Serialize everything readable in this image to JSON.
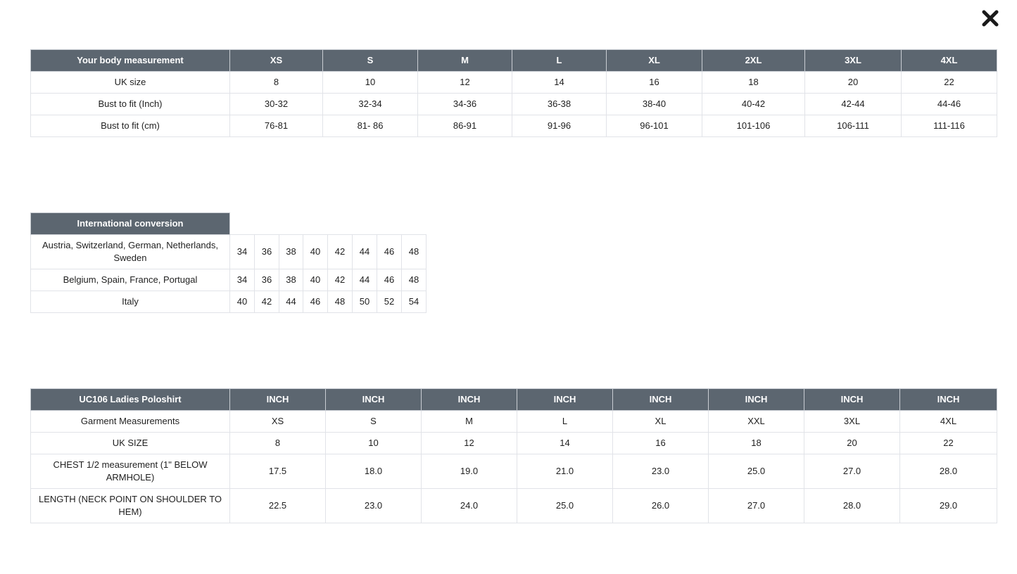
{
  "close_label": "Close",
  "body_table": {
    "header": [
      "Your body measurement",
      "XS",
      "S",
      "M",
      "L",
      "XL",
      "2XL",
      "3XL",
      "4XL"
    ],
    "rows": [
      [
        "UK size",
        "8",
        "10",
        "12",
        "14",
        "16",
        "18",
        "20",
        "22"
      ],
      [
        "Bust to fit (Inch)",
        "30-32",
        "32-34",
        "34-36",
        "36-38",
        "38-40",
        "40-42",
        "42-44",
        "44-46"
      ],
      [
        "Bust to fit (cm)",
        "76-81",
        "81- 86",
        "86-91",
        "91-96",
        "96-101",
        "101-106",
        "106-111",
        "111-116"
      ]
    ]
  },
  "intl_table": {
    "header": "International conversion",
    "rows": [
      [
        "Austria, Switzerland, German, Netherlands, Sweden",
        "34",
        "36",
        "38",
        "40",
        "42",
        "44",
        "46",
        "48"
      ],
      [
        "Belgium, Spain, France, Portugal",
        "34",
        "36",
        "38",
        "40",
        "42",
        "44",
        "46",
        "48"
      ],
      [
        "Italy",
        "40",
        "42",
        "44",
        "46",
        "48",
        "50",
        "52",
        "54"
      ]
    ]
  },
  "polo_table": {
    "header": [
      "UC106 Ladies Poloshirt",
      "INCH",
      "INCH",
      "INCH",
      "INCH",
      "INCH",
      "INCH",
      "INCH",
      "INCH"
    ],
    "rows": [
      [
        "Garment Measurements",
        "XS",
        "S",
        "M",
        "L",
        "XL",
        "XXL",
        "3XL",
        "4XL"
      ],
      [
        "UK SIZE",
        "8",
        "10",
        "12",
        "14",
        "16",
        "18",
        "20",
        "22"
      ],
      [
        "CHEST 1/2 measurement (1\" BELOW ARMHOLE)",
        "17.5",
        "18.0",
        "19.0",
        "21.0",
        "23.0",
        "25.0",
        "27.0",
        "28.0"
      ],
      [
        "LENGTH (NECK POINT ON SHOULDER TO HEM)",
        "22.5",
        "23.0",
        "24.0",
        "25.0",
        "26.0",
        "27.0",
        "28.0",
        "29.0"
      ]
    ]
  }
}
